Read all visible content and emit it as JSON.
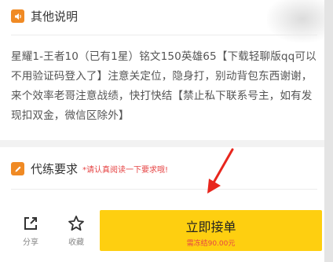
{
  "section_other": {
    "title": "其他说明",
    "icon": "speaker-icon",
    "description": "星耀1-王者10（已有1星）铭文150英雄65【下载轻聊版qq可以不用验证码登入了】注意关定位，隐身打，别动背包东西谢谢，来个效率老哥注意战绩，快打快结【禁止私下联系号主，如有发现扣双金，微信区除外】"
  },
  "section_requirements": {
    "title": "代练要求",
    "icon": "pencil-icon",
    "note": "*请认真阅读一下要求哦!"
  },
  "bottom_bar": {
    "share_label": "分享",
    "favorite_label": "收藏",
    "cta_label": "立即接单",
    "cta_sub": "需冻结90.00元"
  },
  "colors": {
    "accent": "#fecf10",
    "icon_orange": "#f08a24",
    "warning_red": "#e64545",
    "annotation_red": "#e8261d"
  }
}
